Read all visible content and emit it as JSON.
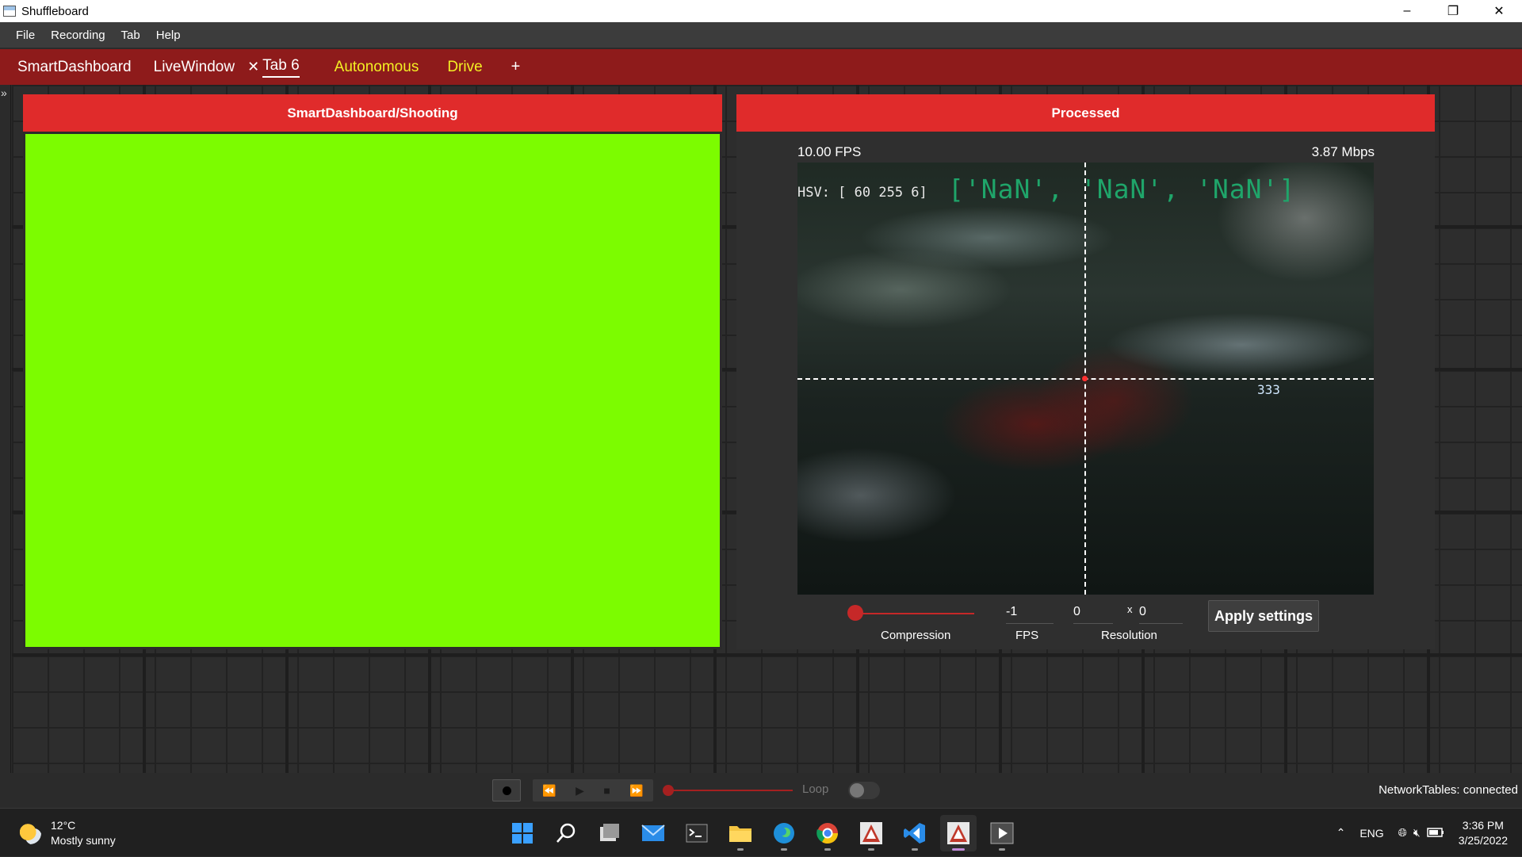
{
  "window": {
    "title": "Shuffleboard"
  },
  "menu": [
    "File",
    "Recording",
    "Tab",
    "Help"
  ],
  "tabs": [
    {
      "label": "SmartDashboard",
      "color": "#ffffff"
    },
    {
      "label": "LiveWindow",
      "color": "#ffffff"
    },
    {
      "label": "Tab 6",
      "color": "#ffffff",
      "active": true,
      "closable": true
    },
    {
      "label": "Autonomous",
      "color": "#f3ef24"
    },
    {
      "label": "Drive",
      "color": "#f3ef24"
    }
  ],
  "add_tab": "+",
  "widgets": {
    "shooting": {
      "title": "SmartDashboard/Shooting",
      "fill_color": "#7cfc00"
    },
    "processed": {
      "title": "Processed",
      "fps": "10.00 FPS",
      "bitrate": "3.87 Mbps",
      "overlay_hsv": "HSV: [ 60 255   6]",
      "overlay_values": "['NaN', 'NaN', 'NaN']",
      "overlay_number": "333",
      "controls": {
        "compression_label": "Compression",
        "fps_value": "-1",
        "fps_label": "FPS",
        "res_width": "0",
        "res_x": "x",
        "res_height": "0",
        "resolution_label": "Resolution",
        "apply_label": "Apply settings"
      }
    }
  },
  "playback": {
    "loop_label": "Loop",
    "status": "NetworkTables: connected"
  },
  "taskbar": {
    "weather_temp": "12°C",
    "weather_desc": "Mostly sunny",
    "lang": "ENG",
    "time": "3:36 PM",
    "date": "3/25/2022",
    "apps": [
      "start-icon",
      "search-icon",
      "task-view-icon",
      "mail-icon",
      "terminal-icon",
      "file-explorer-icon",
      "edge-icon",
      "chrome-icon",
      "frc-app-icon",
      "vscode-icon",
      "shuffleboard-icon",
      "media-player-icon"
    ]
  }
}
